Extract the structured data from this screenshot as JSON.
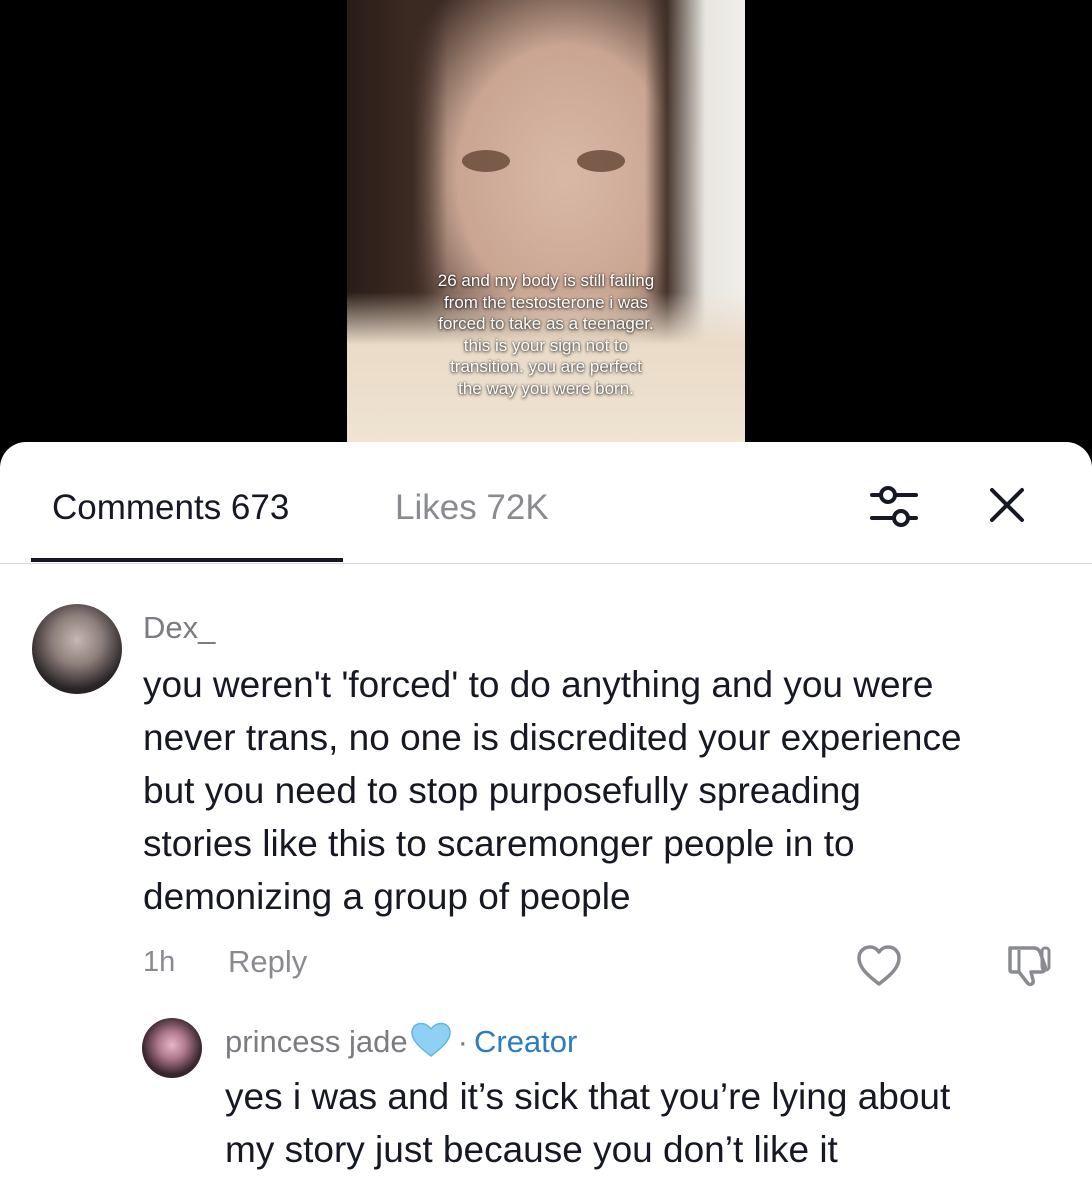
{
  "video": {
    "caption_lines": [
      "26 and my body is still failing",
      "from the testosterone i was",
      "forced to take as a teenager.",
      "this is your sign not to",
      "transition. you are perfect",
      "the way you were born."
    ]
  },
  "tabs": {
    "comments_label": "Comments 673",
    "likes_label": "Likes 72K"
  },
  "icons": {
    "filter": "sliders-icon",
    "close": "close-icon",
    "like": "heart-outline-icon",
    "dislike": "thumbs-down-icon",
    "badge": "blue-heart-emoji"
  },
  "colors": {
    "accent_creator": "#2b7cc0",
    "muted_text": "#8a8b91",
    "primary_text": "#161823",
    "badge_heart": "#8fd0f5"
  },
  "comments": [
    {
      "username": "Dex_",
      "body_lines": [
        "you weren't 'forced' to do anything and you were",
        "never trans, no one is discredited your experience",
        "but you need to stop purposefully spreading",
        "stories like this to scaremonger people in to",
        "demonizing a group of people"
      ],
      "time": "1h",
      "reply_label": "Reply",
      "replies": [
        {
          "username": "princess jade",
          "separator": "·",
          "creator_label": "Creator",
          "body_lines": [
            "yes i was and it’s sick that you’re lying about",
            "my story just because you don’t like it"
          ]
        }
      ]
    }
  ]
}
